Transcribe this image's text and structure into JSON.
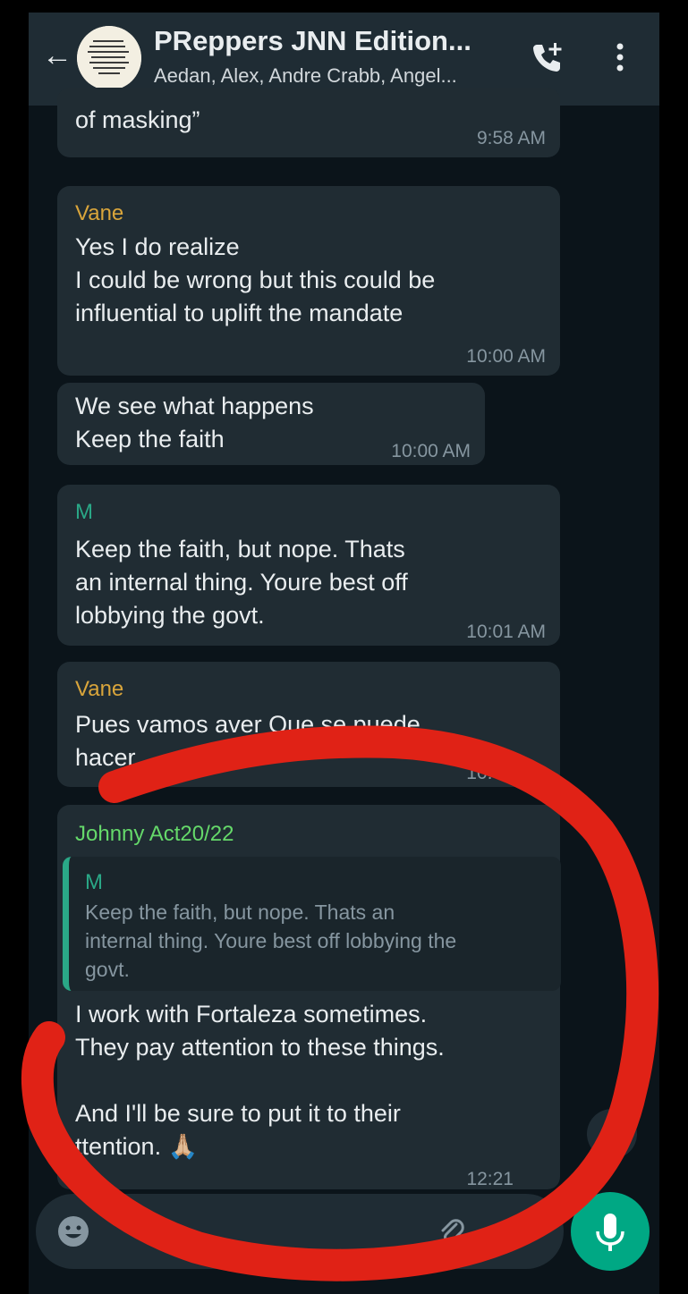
{
  "header": {
    "title": "PReppers JNN Edition...",
    "subtitle": "Aedan, Alex, Andre Crabb, Angel...",
    "back_icon": "arrow-left-icon",
    "call_icon": "add-call-icon",
    "menu_icon": "more-vertical-icon"
  },
  "colors": {
    "header_bg": "#1f2c34",
    "chat_bg": "#0b141a",
    "bubble_bg": "#202c33",
    "sender_vane": "#d9a53b",
    "sender_m": "#2aa887",
    "sender_johnny": "#65d96a",
    "accent_green": "#00a884",
    "annotation_red": "#e02216"
  },
  "messages": [
    {
      "sender": "",
      "text": "of masking”",
      "time": "9:58 AM"
    },
    {
      "sender": "Vane",
      "text": "Yes I do realize\nI could be wrong but this could be\ninfluential to uplift the mandate",
      "time": "10:00 AM"
    },
    {
      "sender": "",
      "text": "We see what happens\nKeep the faith",
      "time": "10:00 AM"
    },
    {
      "sender": "M",
      "text": "Keep the faith, but nope. Thats\nan internal thing. Youre best off\nlobbying the govt.",
      "time": "10:01 AM"
    },
    {
      "sender": "Vane",
      "text": "Pues vamos aver Que se puede\nhacer",
      "time": "10:03 AM"
    },
    {
      "sender": "Johnny Act20/22",
      "quote": {
        "sender": "M",
        "text": "Keep the faith, but nope. Thats an\ninternal thing. Youre best off lobbying the\ngovt."
      },
      "text": "I work with Fortaleza sometimes.\nThey pay attention to these things.\n\nAnd I'll be sure to put it to their\nttention. 🙏🏼",
      "time": "12:21"
    }
  ],
  "input": {
    "emoji_icon": "emoji-icon",
    "attach_icon": "paperclip-icon",
    "camera_icon": "camera-icon",
    "mic_icon": "microphone-icon",
    "scroll_icon": "double-chevron-down-icon"
  }
}
